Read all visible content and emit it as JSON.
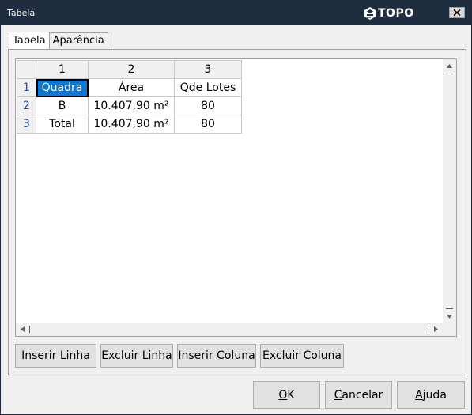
{
  "window": {
    "title": "Tabela",
    "logo_text": "TOPO"
  },
  "tabs": [
    {
      "label": "Tabela",
      "active": true
    },
    {
      "label": "Aparência",
      "active": false
    }
  ],
  "grid": {
    "column_headers": [
      "1",
      "2",
      "3"
    ],
    "rows": [
      {
        "header": "1",
        "cells": [
          "Quadra",
          "Área",
          "Qde Lotes"
        ]
      },
      {
        "header": "2",
        "cells": [
          "B",
          "10.407,90 m²",
          "80"
        ]
      },
      {
        "header": "3",
        "cells": [
          "Total",
          "10.407,90 m²",
          "80"
        ]
      }
    ],
    "selected_cell": "Quadra"
  },
  "grid_buttons": {
    "insert_row": "Inserir Linha",
    "delete_row": "Excluir Linha",
    "insert_column": "Inserir Coluna",
    "delete_column": "Excluir Coluna"
  },
  "dialog_buttons": {
    "ok_first": "O",
    "ok_rest": "K",
    "cancel_first": "C",
    "cancel_rest": "ancelar",
    "help_first": "A",
    "help_rest": "juda"
  },
  "colors": {
    "titlebar": "#1f2d40",
    "selection": "#0a78d7",
    "row_header_text": "#1c4fb0"
  }
}
